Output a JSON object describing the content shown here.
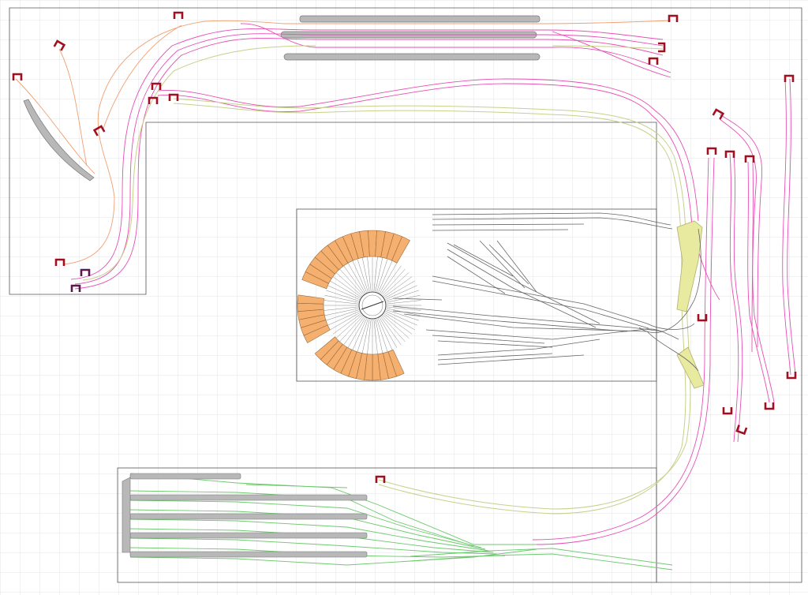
{
  "canvas": {
    "background": "#ffffff",
    "grid_color": "#e1e4e8",
    "board_outline_color": "#555555"
  },
  "colors": {
    "track_pink": "#e64fb5",
    "track_orange": "#f0a070",
    "track_olive": "#c8d08a",
    "track_green": "#6cc96c",
    "track_gray": "#666666",
    "bumper_red": "#a01020",
    "bumper_purple": "#5a1850",
    "platform_gray": "#b8b8b8",
    "roundhouse_fill": "#f5b070",
    "roundhouse_stroke": "#9a6a3a",
    "bridge_yellow": "#e8eaa0"
  },
  "scene": {
    "regions": [
      "upper-left-layout-board",
      "upper-main-board",
      "right-wing-board",
      "center-yard-board",
      "lower-staging-board"
    ],
    "features": [
      "pink-mainline-tracks",
      "orange-branch-track",
      "olive-connecting-track",
      "green-staging-yard",
      "gray-roundhouse-yard",
      "turntable",
      "roundhouse-stalls",
      "passenger-platforms",
      "bridges",
      "buffer-stops"
    ]
  }
}
